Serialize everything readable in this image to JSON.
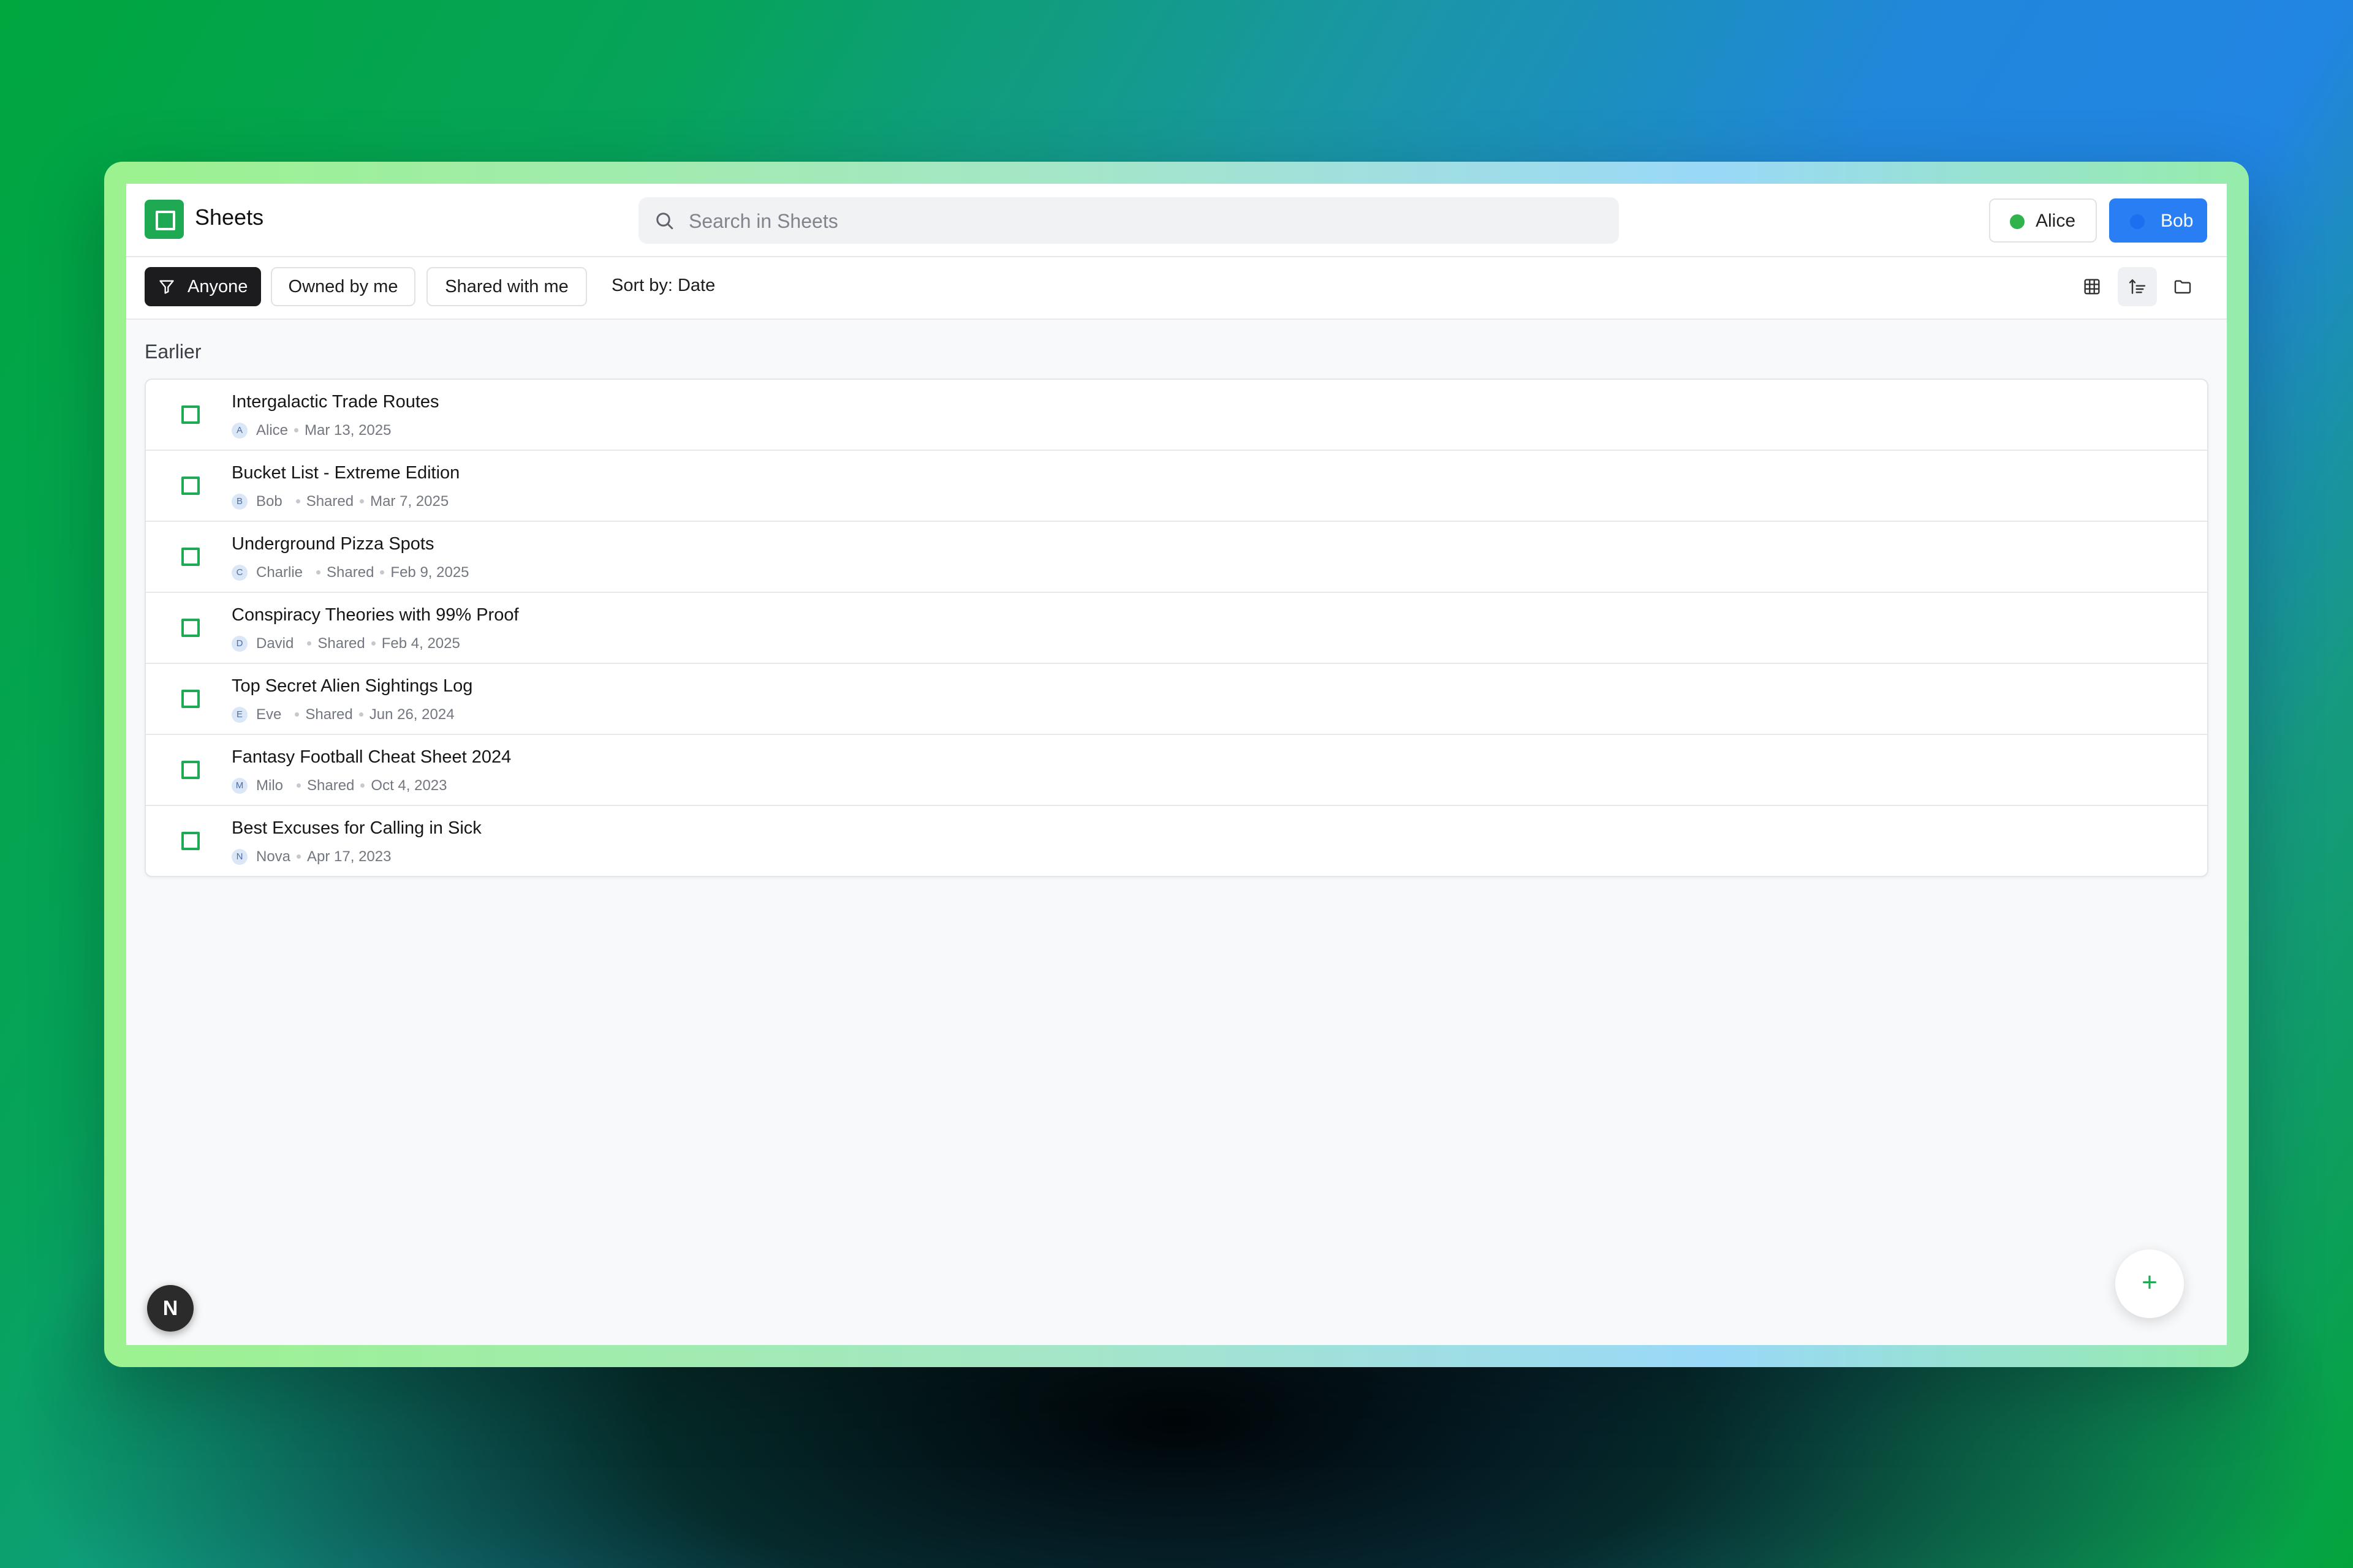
{
  "app": {
    "title": "Sheets",
    "accent_color": "#1ea952"
  },
  "search": {
    "placeholder": "Search in Sheets",
    "value": ""
  },
  "users": [
    {
      "name": "Alice",
      "dot_color": "#2fb34a",
      "active": false
    },
    {
      "name": "Bob",
      "dot_color": "#1e6ff0",
      "active": true
    }
  ],
  "toolbar": {
    "filters": [
      {
        "label": "Anyone",
        "active": true,
        "icon": "filter-icon"
      },
      {
        "label": "Owned by me",
        "active": false
      },
      {
        "label": "Shared with me",
        "active": false
      }
    ],
    "sort_label": "Sort by: Date",
    "view_icons": [
      "grid-view-icon",
      "sort-list-icon",
      "folder-icon"
    ]
  },
  "section": {
    "label": "Earlier"
  },
  "files": [
    {
      "title": "Intergalactic Trade Routes",
      "owner": "Alice",
      "initial": "A",
      "shared": "",
      "date": "Mar 13, 2025"
    },
    {
      "title": "Bucket List - Extreme Edition",
      "owner": "Bob",
      "initial": "B",
      "shared": "Shared",
      "date": "Mar 7, 2025"
    },
    {
      "title": "Underground Pizza Spots",
      "owner": "Charlie",
      "initial": "C",
      "shared": "Shared",
      "date": "Feb 9, 2025"
    },
    {
      "title": "Conspiracy Theories with 99% Proof",
      "owner": "David",
      "initial": "D",
      "shared": "Shared",
      "date": "Feb 4, 2025"
    },
    {
      "title": "Top Secret Alien Sightings Log",
      "owner": "Eve",
      "initial": "E",
      "shared": "Shared",
      "date": "Jun 26, 2024"
    },
    {
      "title": "Fantasy Football Cheat Sheet 2024",
      "owner": "Milo",
      "initial": "M",
      "shared": "Shared",
      "date": "Oct 4, 2023"
    },
    {
      "title": "Best Excuses for Calling in Sick",
      "owner": "Nova",
      "initial": "N",
      "shared": "",
      "date": "Apr 17, 2023"
    }
  ],
  "badge": {
    "label": "N"
  },
  "fab": {
    "label": "+"
  }
}
